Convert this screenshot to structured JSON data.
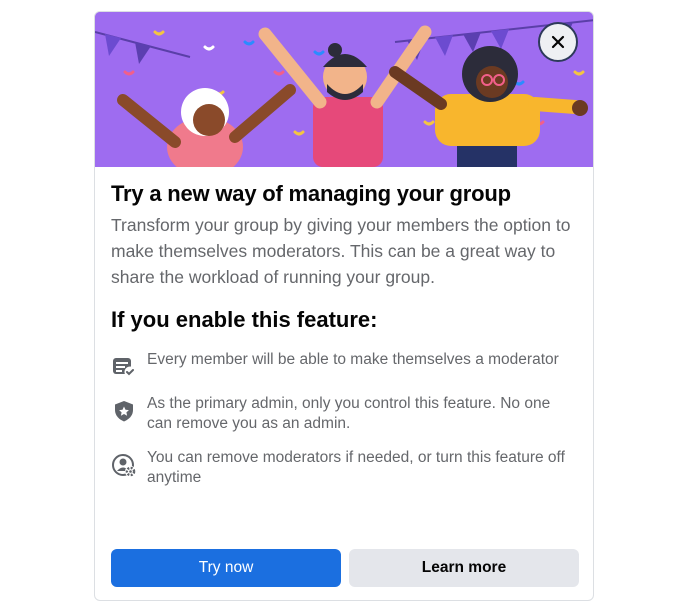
{
  "dialog": {
    "title": "Try a new way of managing your group",
    "description": "Transform your group by giving your members the option to make themselves moderators. This can be a great way to share the workload of running your group.",
    "subtitle": "If you enable this feature:",
    "features": [
      {
        "icon": "checklist-icon",
        "text": "Every member will be able to make themselves a moderator"
      },
      {
        "icon": "shield-star-icon",
        "text": "As the primary admin, only you control this feature. No one can remove you as an admin."
      },
      {
        "icon": "person-gear-icon",
        "text": "You can remove moderators if needed, or turn this feature off anytime"
      }
    ],
    "primary_button": "Try now",
    "secondary_button": "Learn more"
  },
  "colors": {
    "hero_background": "#9e6cf0",
    "primary": "#1b6fe0",
    "secondary": "#e4e6eb",
    "text_primary": "#050505",
    "text_secondary": "#65676b"
  }
}
